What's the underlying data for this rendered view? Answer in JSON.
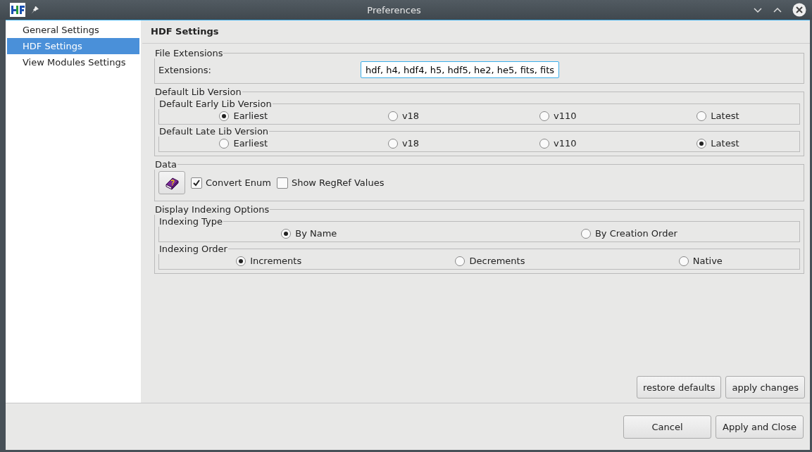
{
  "window": {
    "title": "Preferences"
  },
  "sidebar": {
    "items": [
      {
        "label": "General Settings",
        "selected": false
      },
      {
        "label": "HDF Settings",
        "selected": true
      },
      {
        "label": "View Modules Settings",
        "selected": false
      }
    ]
  },
  "panel_title": "HDF Settings",
  "file_extensions": {
    "title": "File Extensions",
    "label": "Extensions:",
    "value": "hdf, h4, hdf4, h5, hdf5, he2, he5, fits, fits"
  },
  "default_lib_version": {
    "title": "Default Lib Version",
    "groups": [
      {
        "title": "Default Early Lib Version",
        "options": [
          {
            "label": "Earliest",
            "selected": true
          },
          {
            "label": "v18",
            "selected": false
          },
          {
            "label": "v110",
            "selected": false
          },
          {
            "label": "Latest",
            "selected": false
          }
        ]
      },
      {
        "title": "Default Late Lib Version",
        "options": [
          {
            "label": "Earliest",
            "selected": false
          },
          {
            "label": "v18",
            "selected": false
          },
          {
            "label": "v110",
            "selected": false
          },
          {
            "label": "Latest",
            "selected": true
          }
        ]
      }
    ]
  },
  "data": {
    "title": "Data",
    "checkboxes": [
      {
        "label": "Convert Enum",
        "checked": true
      },
      {
        "label": "Show RegRef Values",
        "checked": false
      }
    ]
  },
  "display_indexing_options": {
    "title": "Display Indexing Options",
    "groups": [
      {
        "title": "Indexing Type",
        "options": [
          {
            "label": "By Name",
            "selected": true
          },
          {
            "label": "By Creation Order",
            "selected": false
          }
        ]
      },
      {
        "title": "Indexing Order",
        "options": [
          {
            "label": "Increments",
            "selected": true
          },
          {
            "label": "Decrements",
            "selected": false
          },
          {
            "label": "Native",
            "selected": false
          }
        ]
      }
    ]
  },
  "panel_buttons": [
    "restore defaults",
    "apply changes"
  ],
  "dialog_buttons": [
    "Cancel",
    "Apply and Close"
  ]
}
